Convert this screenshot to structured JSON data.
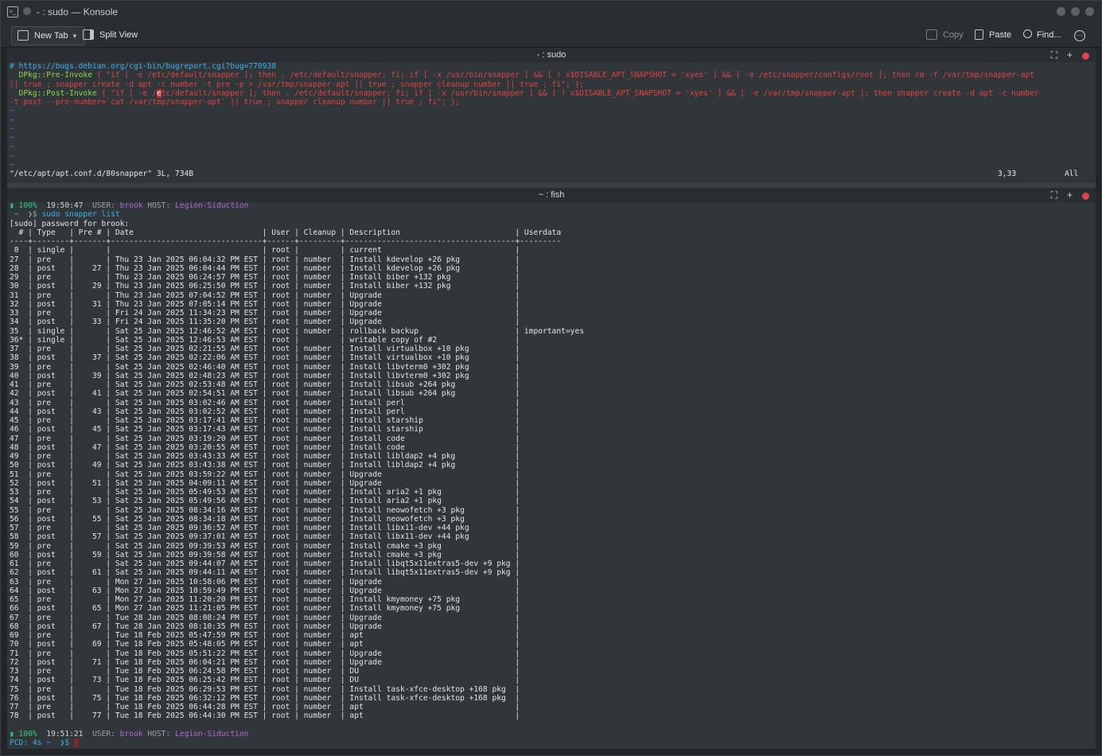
{
  "window": {
    "title": "- : sudo — Konsole"
  },
  "toolbar": {
    "new_tab": "New Tab",
    "split_view": "Split View",
    "copy": "Copy",
    "paste": "Paste",
    "find": "Find..."
  },
  "top_pane": {
    "title": "- : sudo",
    "comment_line": "# https://bugs.debian.org/cgi-bin/bugreport.cgi?bug=770938",
    "pre_key": "  DPkg::Pre-Invoke",
    "pre_val_1": " { \"if [ -e /etc/default/snapper ]; then . /etc/default/snapper; fi; if [ -x /usr/bin/snapper ] && [ ! x$DISABLE_APT_SNAPSHOT = 'xyes' ] && [ -e /etc/snapper/configs/root ]; then rm -f /var/tmp/snapper-apt",
    "pre_val_2": "|| true ; snapper create -d apt -c number -t pre -p > /var/tmp/snapper-apt || true ; snapper cleanup number || true ; fi\"; };",
    "post_key": "  DPkg::Post-Invoke",
    "post_val_a": " { \"if [ -e /",
    "post_cursor": "e",
    "post_val_b": "tc/default/snapper ]; then . /etc/default/snapper; fi; if [ -x /usr/bin/snapper ] && [ ! x$DISABLE_APT_SNAPSHOT = 'xyes' ] && [ -e /var/tmp/snapper-apt ]; then snapper create -d apt -c number",
    "post_val_2": "-t post --pre-number=`cat /var/tmp/snapper-apt` || true ; snapper cleanup number || true ; fi\"; };",
    "tilde": "~",
    "file_status": "\"/etc/apt/apt.conf.d/80snapper\" 3L, 734B",
    "cursor_pos": "3,33",
    "scroll_pos": "All"
  },
  "bottom_pane": {
    "title": "~ : fish",
    "prompt1": {
      "battery": "▮ 100%",
      "time": "19:50:47",
      "user_label": "USER:",
      "user": "brook",
      "host_label": "HOST:",
      "host": "Legion-Siduction"
    },
    "command_prefix": " ~  ❯$ ",
    "command": "sudo snapper list",
    "password_prompt": "[sudo] password for brook:",
    "header_line": "  # | Type   | Pre # | Date                            | User | Cleanup | Description                         | Userdata",
    "separator_line": "----+--------+-------+---------------------------------+------+---------+-------------------------------------+---------",
    "rows": [
      [
        " 0 ",
        "single",
        "",
        "",
        "root",
        "",
        "current",
        ""
      ],
      [
        "27 ",
        "pre",
        "",
        "Thu 23 Jan 2025 06:04:32 PM EST",
        "root",
        "number",
        "Install kdevelop +26 pkg",
        ""
      ],
      [
        "28 ",
        "post",
        "27",
        "Thu 23 Jan 2025 06:04:44 PM EST",
        "root",
        "number",
        "Install kdevelop +26 pkg",
        ""
      ],
      [
        "29 ",
        "pre",
        "",
        "Thu 23 Jan 2025 06:24:57 PM EST",
        "root",
        "number",
        "Install biber +132 pkg",
        ""
      ],
      [
        "30 ",
        "post",
        "29",
        "Thu 23 Jan 2025 06:25:50 PM EST",
        "root",
        "number",
        "Install biber +132 pkg",
        ""
      ],
      [
        "31 ",
        "pre",
        "",
        "Thu 23 Jan 2025 07:04:52 PM EST",
        "root",
        "number",
        "Upgrade",
        ""
      ],
      [
        "32 ",
        "post",
        "31",
        "Thu 23 Jan 2025 07:05:14 PM EST",
        "root",
        "number",
        "Upgrade",
        ""
      ],
      [
        "33 ",
        "pre",
        "",
        "Fri 24 Jan 2025 11:34:23 PM EST",
        "root",
        "number",
        "Upgrade",
        ""
      ],
      [
        "34 ",
        "post",
        "33",
        "Fri 24 Jan 2025 11:35:20 PM EST",
        "root",
        "number",
        "Upgrade",
        ""
      ],
      [
        "35 ",
        "single",
        "",
        "Sat 25 Jan 2025 12:46:52 AM EST",
        "root",
        "number",
        "rollback backup",
        "important=yes"
      ],
      [
        "36*",
        "single",
        "",
        "Sat 25 Jan 2025 12:46:53 AM EST",
        "root",
        "",
        "writable copy of #2",
        ""
      ],
      [
        "37 ",
        "pre",
        "",
        "Sat 25 Jan 2025 02:21:55 AM EST",
        "root",
        "number",
        "Install virtualbox +10 pkg",
        ""
      ],
      [
        "38 ",
        "post",
        "37",
        "Sat 25 Jan 2025 02:22:06 AM EST",
        "root",
        "number",
        "Install virtualbox +10 pkg",
        ""
      ],
      [
        "39 ",
        "pre",
        "",
        "Sat 25 Jan 2025 02:46:40 AM EST",
        "root",
        "number",
        "Install libvterm0 +302 pkg",
        ""
      ],
      [
        "40 ",
        "post",
        "39",
        "Sat 25 Jan 2025 02:48:23 AM EST",
        "root",
        "number",
        "Install libvterm0 +302 pkg",
        ""
      ],
      [
        "41 ",
        "pre",
        "",
        "Sat 25 Jan 2025 02:53:48 AM EST",
        "root",
        "number",
        "Install libsub +264 pkg",
        ""
      ],
      [
        "42 ",
        "post",
        "41",
        "Sat 25 Jan 2025 02:54:51 AM EST",
        "root",
        "number",
        "Install libsub +264 pkg",
        ""
      ],
      [
        "43 ",
        "pre",
        "",
        "Sat 25 Jan 2025 03:02:46 AM EST",
        "root",
        "number",
        "Install perl",
        ""
      ],
      [
        "44 ",
        "post",
        "43",
        "Sat 25 Jan 2025 03:02:52 AM EST",
        "root",
        "number",
        "Install perl",
        ""
      ],
      [
        "45 ",
        "pre",
        "",
        "Sat 25 Jan 2025 03:17:41 AM EST",
        "root",
        "number",
        "Install starship",
        ""
      ],
      [
        "46 ",
        "post",
        "45",
        "Sat 25 Jan 2025 03:17:43 AM EST",
        "root",
        "number",
        "Install starship",
        ""
      ],
      [
        "47 ",
        "pre",
        "",
        "Sat 25 Jan 2025 03:19:20 AM EST",
        "root",
        "number",
        "Install code",
        ""
      ],
      [
        "48 ",
        "post",
        "47",
        "Sat 25 Jan 2025 03:20:55 AM EST",
        "root",
        "number",
        "Install code",
        ""
      ],
      [
        "49 ",
        "pre",
        "",
        "Sat 25 Jan 2025 03:43:33 AM EST",
        "root",
        "number",
        "Install libldap2 +4 pkg",
        ""
      ],
      [
        "50 ",
        "post",
        "49",
        "Sat 25 Jan 2025 03:43:38 AM EST",
        "root",
        "number",
        "Install libldap2 +4 pkg",
        ""
      ],
      [
        "51 ",
        "pre",
        "",
        "Sat 25 Jan 2025 03:59:22 AM EST",
        "root",
        "number",
        "Upgrade",
        ""
      ],
      [
        "52 ",
        "post",
        "51",
        "Sat 25 Jan 2025 04:09:11 AM EST",
        "root",
        "number",
        "Upgrade",
        ""
      ],
      [
        "53 ",
        "pre",
        "",
        "Sat 25 Jan 2025 05:49:53 AM EST",
        "root",
        "number",
        "Install aria2 +1 pkg",
        ""
      ],
      [
        "54 ",
        "post",
        "53",
        "Sat 25 Jan 2025 05:49:56 AM EST",
        "root",
        "number",
        "Install aria2 +1 pkg",
        ""
      ],
      [
        "55 ",
        "pre",
        "",
        "Sat 25 Jan 2025 08:34:16 AM EST",
        "root",
        "number",
        "Install neowofetch +3 pkg",
        ""
      ],
      [
        "56 ",
        "post",
        "55",
        "Sat 25 Jan 2025 08:34:18 AM EST",
        "root",
        "number",
        "Install neowofetch +3 pkg",
        ""
      ],
      [
        "57 ",
        "pre",
        "",
        "Sat 25 Jan 2025 09:36:52 AM EST",
        "root",
        "number",
        "Install libx11-dev +44 pkg",
        ""
      ],
      [
        "58 ",
        "post",
        "57",
        "Sat 25 Jan 2025 09:37:01 AM EST",
        "root",
        "number",
        "Install libx11-dev +44 pkg",
        ""
      ],
      [
        "59 ",
        "pre",
        "",
        "Sat 25 Jan 2025 09:39:53 AM EST",
        "root",
        "number",
        "Install cmake +3 pkg",
        ""
      ],
      [
        "60 ",
        "post",
        "59",
        "Sat 25 Jan 2025 09:39:58 AM EST",
        "root",
        "number",
        "Install cmake +3 pkg",
        ""
      ],
      [
        "61 ",
        "pre",
        "",
        "Sat 25 Jan 2025 09:44:07 AM EST",
        "root",
        "number",
        "Install libqt5x11extras5-dev +9 pkg",
        ""
      ],
      [
        "62 ",
        "post",
        "61",
        "Sat 25 Jan 2025 09:44:11 AM EST",
        "root",
        "number",
        "Install libqt5x11extras5-dev +9 pkg",
        ""
      ],
      [
        "63 ",
        "pre",
        "",
        "Mon 27 Jan 2025 10:58:06 PM EST",
        "root",
        "number",
        "Upgrade",
        ""
      ],
      [
        "64 ",
        "post",
        "63",
        "Mon 27 Jan 2025 10:59:49 PM EST",
        "root",
        "number",
        "Upgrade",
        ""
      ],
      [
        "65 ",
        "pre",
        "",
        "Mon 27 Jan 2025 11:20:20 PM EST",
        "root",
        "number",
        "Install kmymoney +75 pkg",
        ""
      ],
      [
        "66 ",
        "post",
        "65",
        "Mon 27 Jan 2025 11:21:05 PM EST",
        "root",
        "number",
        "Install kmymoney +75 pkg",
        ""
      ],
      [
        "67 ",
        "pre",
        "",
        "Tue 28 Jan 2025 08:08:24 PM EST",
        "root",
        "number",
        "Upgrade",
        ""
      ],
      [
        "68 ",
        "post",
        "67",
        "Tue 28 Jan 2025 08:10:35 PM EST",
        "root",
        "number",
        "Upgrade",
        ""
      ],
      [
        "69 ",
        "pre",
        "",
        "Tue 18 Feb 2025 05:47:59 PM EST",
        "root",
        "number",
        "apt",
        ""
      ],
      [
        "70 ",
        "post",
        "69",
        "Tue 18 Feb 2025 05:48:05 PM EST",
        "root",
        "number",
        "apt",
        ""
      ],
      [
        "71 ",
        "pre",
        "",
        "Tue 18 Feb 2025 05:51:22 PM EST",
        "root",
        "number",
        "Upgrade",
        ""
      ],
      [
        "72 ",
        "post",
        "71",
        "Tue 18 Feb 2025 06:04:21 PM EST",
        "root",
        "number",
        "Upgrade",
        ""
      ],
      [
        "73 ",
        "pre",
        "",
        "Tue 18 Feb 2025 06:24:58 PM EST",
        "root",
        "number",
        "DU",
        ""
      ],
      [
        "74 ",
        "post",
        "73",
        "Tue 18 Feb 2025 06:25:42 PM EST",
        "root",
        "number",
        "DU",
        ""
      ],
      [
        "75 ",
        "pre",
        "",
        "Tue 18 Feb 2025 06:29:53 PM EST",
        "root",
        "number",
        "Install task-xfce-desktop +168 pkg",
        ""
      ],
      [
        "76 ",
        "post",
        "75",
        "Tue 18 Feb 2025 06:32:12 PM EST",
        "root",
        "number",
        "Install task-xfce-desktop +168 pkg",
        ""
      ],
      [
        "77 ",
        "pre",
        "",
        "Tue 18 Feb 2025 06:44:28 PM EST",
        "root",
        "number",
        "apt",
        ""
      ],
      [
        "78 ",
        "post",
        "77",
        "Tue 18 Feb 2025 06:44:30 PM EST",
        "root",
        "number",
        "apt",
        ""
      ]
    ],
    "prompt2": {
      "battery": "▮ 100%",
      "time": "19:51:21",
      "user_label": "USER:",
      "user": "brook",
      "host_label": "HOST:",
      "host": "Legion-Siduction"
    },
    "pcd_line": "PCD: 4s ~  ❯$ "
  },
  "colors": {
    "window_bg": "#232629",
    "pane_bg": "#31363b",
    "accent_blue": "#3daee9",
    "comment_blue": "#3daee9",
    "keyword_green": "#8bd74a",
    "string_red": "#e0433f",
    "host_purple": "#b36ad6",
    "close_red": "#da4453"
  },
  "icons": {
    "app": "terminal-icon",
    "new_tab": "new-tab-icon",
    "split_view": "split-view-icon",
    "copy": "copy-icon",
    "paste": "paste-icon",
    "find": "search-icon",
    "menu": "hamburger-menu-icon"
  }
}
